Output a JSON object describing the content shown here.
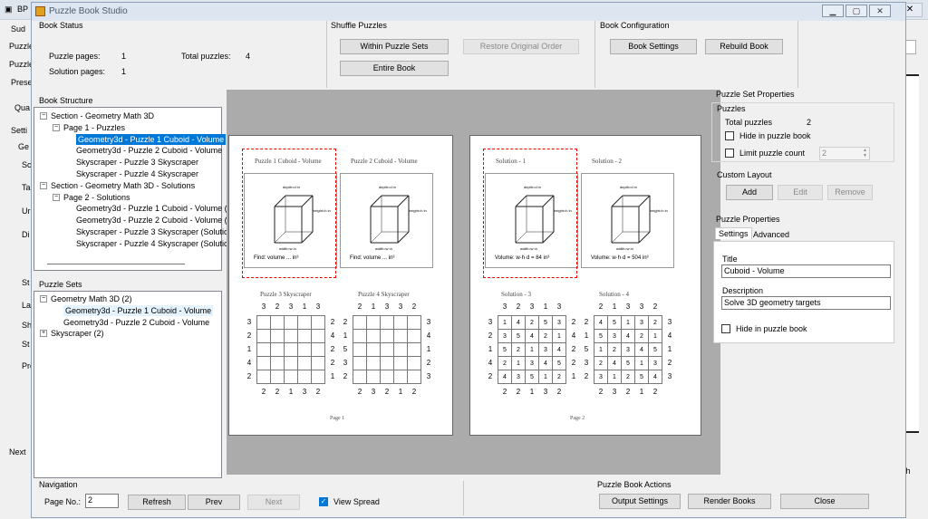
{
  "background": {
    "app_abbrev": "BP",
    "left_labels": [
      "Sud",
      "Puzzle",
      "Puzzle",
      "Prese",
      "Qua",
      "Setti",
      "Ge",
      "Sc",
      "Ta",
      "Ur",
      "Di",
      "St",
      "La",
      "Sh",
      "St",
      "Previ",
      "Next"
    ],
    "right_label": "oth",
    "close_glyph": "✕"
  },
  "window": {
    "title": "Puzzle Book Studio",
    "minimize": "▁",
    "maximize": "▢",
    "close": "✕"
  },
  "book_status": {
    "label": "Book Status",
    "puzzle_pages_label": "Puzzle pages:",
    "puzzle_pages": "1",
    "total_puzzles_label": "Total puzzles:",
    "total_puzzles": "4",
    "solution_pages_label": "Solution pages:",
    "solution_pages": "1"
  },
  "shuffle": {
    "label": "Shuffle Puzzles",
    "within_sets": "Within Puzzle Sets",
    "restore": "Restore Original Order",
    "entire_book": "Entire Book"
  },
  "book_config": {
    "label": "Book Configuration",
    "settings": "Book Settings",
    "rebuild": "Rebuild Book"
  },
  "book_structure": {
    "label": "Book Structure",
    "items": [
      {
        "text": "Section - Geometry Math 3D",
        "level": 0,
        "expander": "−"
      },
      {
        "text": "Page 1 - Puzzles",
        "level": 1,
        "expander": "−"
      },
      {
        "text": "Geometry3d - Puzzle 1 Cuboid - Volume",
        "level": 2,
        "selected": true
      },
      {
        "text": "Geometry3d - Puzzle 2 Cuboid - Volume",
        "level": 2
      },
      {
        "text": "Skyscraper - Puzzle 3 Skyscraper",
        "level": 2
      },
      {
        "text": "Skyscraper - Puzzle 4 Skyscraper",
        "level": 2
      },
      {
        "text": "Section - Geometry Math 3D - Solutions",
        "level": 0,
        "expander": "−"
      },
      {
        "text": "Page 2 - Solutions",
        "level": 1,
        "expander": "−"
      },
      {
        "text": "Geometry3d - Puzzle 1 Cuboid - Volume (S",
        "level": 2
      },
      {
        "text": "Geometry3d - Puzzle 2 Cuboid - Volume (S",
        "level": 2
      },
      {
        "text": "Skyscraper - Puzzle 3 Skyscraper (Solutio",
        "level": 2
      },
      {
        "text": "Skyscraper - Puzzle 4 Skyscraper (Solutic",
        "level": 2
      }
    ]
  },
  "puzzle_sets": {
    "label": "Puzzle Sets",
    "items": [
      {
        "text": "Geometry Math 3D (2)",
        "level": 0,
        "expander": "−"
      },
      {
        "text": "Geometry3d - Puzzle 1 Cuboid - Volume",
        "level": 1,
        "hover": true
      },
      {
        "text": "Geometry3d - Puzzle 2 Cuboid - Volume",
        "level": 1
      },
      {
        "text": "Skyscraper (2)",
        "level": 0,
        "expander": "+"
      }
    ]
  },
  "preview": {
    "page1": {
      "cards": [
        {
          "title": "Puzzle 1 Cuboid - Volume",
          "caption": "Find: volume          ... in³"
        },
        {
          "title": "Puzzle 2 Cuboid - Volume",
          "caption": "Find: volume          ... in³"
        }
      ],
      "sky_titles": [
        "Puzzle 3 Skyscraper",
        "Puzzle 4 Skyscraper"
      ],
      "page_label": "Page 1"
    },
    "page2": {
      "cards": [
        {
          "title": "Solution - 1",
          "caption": "Volume: w·h·d = 84 in³"
        },
        {
          "title": "Solution - 2",
          "caption": "Volume: w·h·d = 504 in³"
        }
      ],
      "sky_titles": [
        "Solution - 3",
        "Solution - 4"
      ],
      "page_label": "Page 2"
    },
    "cube_labels": {
      "depth": "depth=d in",
      "height": "height=h in",
      "width": "width=w in"
    },
    "skyscrapers": [
      {
        "top": [
          "3",
          "2",
          "3",
          "1",
          "3"
        ],
        "bottom": [
          "2",
          "2",
          "1",
          "3",
          "2"
        ],
        "left": [
          "3",
          "2",
          "1",
          "4",
          "2"
        ],
        "right": [
          "2",
          "4",
          "2",
          "2",
          "1"
        ],
        "cells": [
          [
            "",
            "",
            "",
            "",
            ""
          ],
          [
            "",
            "",
            "",
            "",
            ""
          ],
          [
            "",
            "",
            "",
            "",
            ""
          ],
          [
            "",
            "",
            "",
            "",
            ""
          ],
          [
            "",
            "",
            "",
            "",
            ""
          ]
        ]
      },
      {
        "top": [
          "2",
          "1",
          "3",
          "3",
          "2"
        ],
        "bottom": [
          "2",
          "3",
          "2",
          "1",
          "2"
        ],
        "left": [
          "2",
          "1",
          "5",
          "3",
          "2"
        ],
        "right": [
          "3",
          "4",
          "1",
          "2",
          "3"
        ],
        "cells": [
          [
            "",
            "",
            "",
            "",
            ""
          ],
          [
            "",
            "",
            "",
            "",
            ""
          ],
          [
            "",
            "",
            "",
            "",
            ""
          ],
          [
            "",
            "",
            "",
            "",
            ""
          ],
          [
            "",
            "",
            "",
            "",
            ""
          ]
        ]
      },
      {
        "top": [
          "3",
          "2",
          "3",
          "1",
          "3"
        ],
        "bottom": [
          "2",
          "2",
          "1",
          "3",
          "2"
        ],
        "left": [
          "3",
          "2",
          "1",
          "4",
          "2"
        ],
        "right": [
          "2",
          "4",
          "2",
          "2",
          "1"
        ],
        "cells": [
          [
            "1",
            "4",
            "2",
            "5",
            "3"
          ],
          [
            "3",
            "5",
            "4",
            "2",
            "1"
          ],
          [
            "5",
            "2",
            "1",
            "3",
            "4"
          ],
          [
            "2",
            "1",
            "3",
            "4",
            "5"
          ],
          [
            "4",
            "3",
            "5",
            "1",
            "2"
          ]
        ]
      },
      {
        "top": [
          "2",
          "1",
          "3",
          "3",
          "2"
        ],
        "bottom": [
          "2",
          "3",
          "2",
          "1",
          "2"
        ],
        "left": [
          "2",
          "1",
          "5",
          "3",
          "2"
        ],
        "right": [
          "3",
          "4",
          "1",
          "2",
          "3"
        ],
        "cells": [
          [
            "4",
            "5",
            "1",
            "3",
            "2"
          ],
          [
            "5",
            "3",
            "4",
            "2",
            "1"
          ],
          [
            "1",
            "2",
            "3",
            "4",
            "5"
          ],
          [
            "2",
            "4",
            "5",
            "1",
            "3"
          ],
          [
            "3",
            "1",
            "2",
            "5",
            "4"
          ]
        ]
      }
    ]
  },
  "puzzle_set_properties": {
    "label": "Puzzle Set Properties",
    "puzzles_label": "Puzzles",
    "total_label": "Total puzzles",
    "total": "2",
    "hide_label": "Hide in puzzle book",
    "limit_label": "Limit puzzle count",
    "limit_value": "2",
    "custom_layout_label": "Custom Layout",
    "add": "Add",
    "edit": "Edit",
    "remove": "Remove"
  },
  "puzzle_properties": {
    "label": "Puzzle Properties",
    "tabs": [
      "Settings",
      "Advanced"
    ],
    "title_label": "Title",
    "title_value": "Cuboid - Volume",
    "description_label": "Description",
    "description_value": "Solve 3D geometry targets",
    "hide_label": "Hide in puzzle book"
  },
  "navigation": {
    "label": "Navigation",
    "page_no_label": "Page No.:",
    "page_no": "2",
    "refresh": "Refresh",
    "prev": "Prev",
    "next": "Next",
    "view_spread": "View Spread",
    "check": "✓"
  },
  "actions": {
    "label": "Puzzle Book Actions",
    "output_settings": "Output Settings",
    "render_books": "Render Books",
    "close": "Close"
  }
}
